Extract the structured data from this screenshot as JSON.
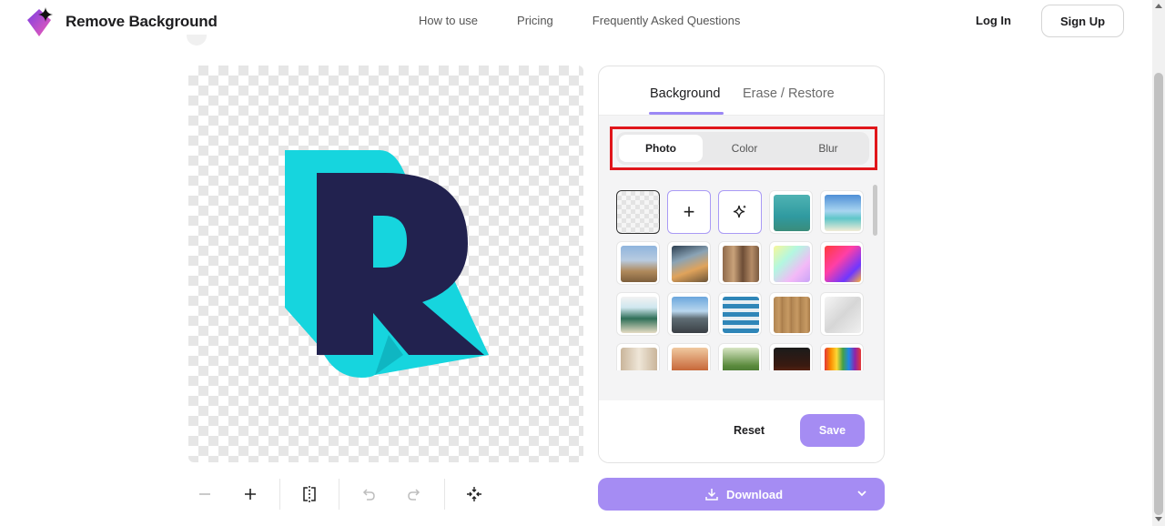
{
  "brand": {
    "name": "Remove Background"
  },
  "nav": {
    "items": [
      "How to use",
      "Pricing",
      "Frequently Asked Questions"
    ]
  },
  "auth": {
    "login": "Log In",
    "signup": "Sign Up"
  },
  "panel": {
    "tabs": [
      "Background",
      "Erase / Restore"
    ],
    "active_tab": "Background",
    "segments": [
      "Photo",
      "Color",
      "Blur"
    ],
    "active_segment": "Photo",
    "reset_label": "Reset",
    "save_label": "Save"
  },
  "download": {
    "label": "Download"
  },
  "colors": {
    "accent": "#a58cf3",
    "highlight": "#e0161b",
    "logo_navy": "#22224f",
    "logo_cyan": "#16d5de"
  },
  "icons": [
    "zoom-out-icon",
    "zoom-in-icon",
    "compare-icon",
    "undo-icon",
    "redo-icon",
    "fit-icon",
    "download-icon",
    "chevron-down-icon",
    "sparkle-icon",
    "plus-icon"
  ]
}
